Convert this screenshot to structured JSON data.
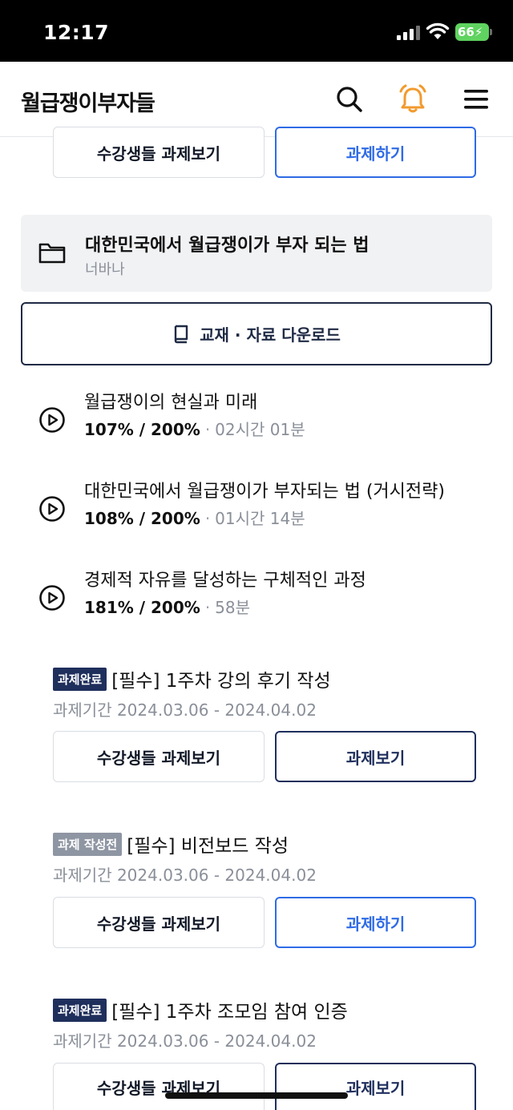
{
  "status_bar": {
    "time": "12:17",
    "battery": "66"
  },
  "header": {
    "logo": "월급쟁이부자들",
    "icons": [
      "search-icon",
      "bell-icon",
      "menu-icon"
    ],
    "bell_color": "#f29a2e"
  },
  "top_buttons": {
    "view_label": "수강생들 과제보기",
    "do_label": "과제하기"
  },
  "folder": {
    "title": "대한민국에서 월급쟁이가 부자 되는 법",
    "author": "너바나"
  },
  "download": {
    "label": "교재 · 자료 다운로드"
  },
  "lessons": [
    {
      "title": "월급쟁이의 현실과 미래",
      "progress": "107% / 200%",
      "duration": "02시간 01분"
    },
    {
      "title": "대한민국에서 월급쟁이가 부자되는 법 (거시전략)",
      "progress": "108% / 200%",
      "duration": "01시간 14분"
    },
    {
      "title": "경제적 자유를 달성하는 구체적인 과정",
      "progress": "181% / 200%",
      "duration": "58분"
    }
  ],
  "tasks": [
    {
      "badge": "과제완료",
      "title": "[필수] 1주차 강의 후기 작성",
      "period": "과제기간 2024.03.06 - 2024.04.02",
      "view_label": "수강생들 과제보기",
      "action_label": "과제보기"
    },
    {
      "badge": "과제 작성전",
      "title": "[필수] 비전보드 작성",
      "period": "과제기간 2024.03.06 - 2024.04.02",
      "view_label": "수강생들 과제보기",
      "action_label": "과제하기"
    },
    {
      "badge": "과제완료",
      "title": "[필수] 1주차 조모임 참여 인증",
      "period": "과제기간 2024.03.06 - 2024.04.02",
      "view_label": "수강생들 과제보기",
      "action_label": "과제보기"
    }
  ],
  "colors": {
    "navy": "#1f2f5c",
    "blue": "#2f6be6",
    "badge_pending": "#8f96a3"
  }
}
